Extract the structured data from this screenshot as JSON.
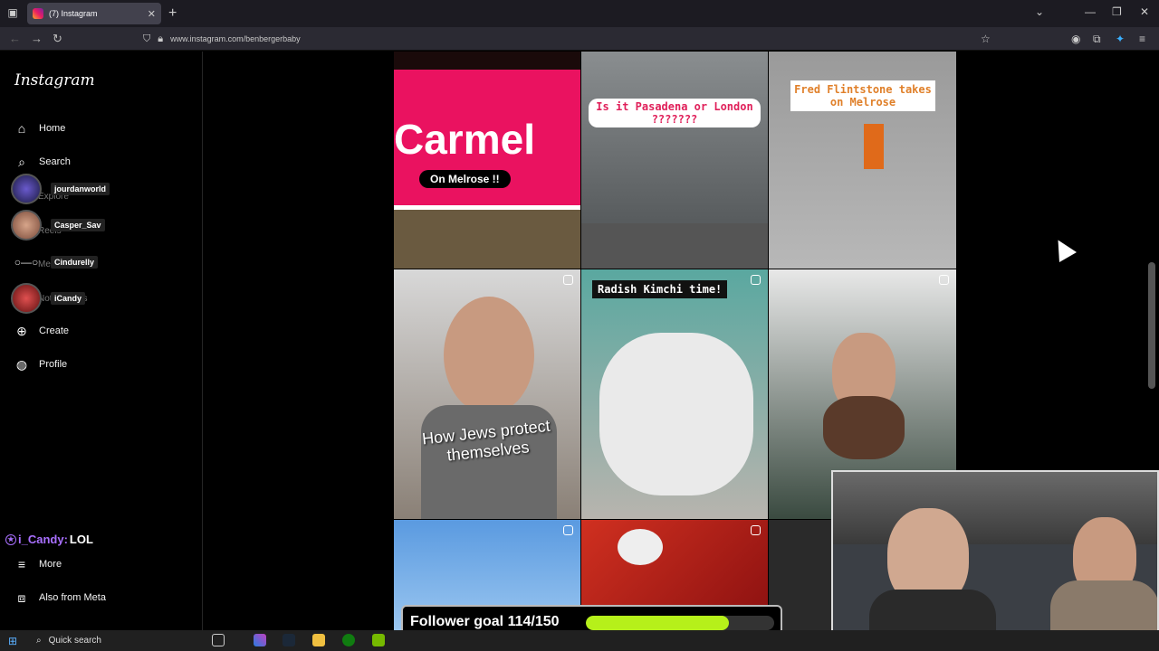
{
  "browser": {
    "tab_title": "(7) Instagram",
    "url": "www.instagram.com/benbergerbaby"
  },
  "sidebar": {
    "logo": "Instagram",
    "items": [
      {
        "label": "Home",
        "icon": "home-icon"
      },
      {
        "label": "Search",
        "icon": "search-icon"
      },
      {
        "label": "Explore",
        "icon": "compass-icon"
      },
      {
        "label": "Reels",
        "icon": "reels-icon"
      },
      {
        "label": "Messages",
        "icon": "messenger-icon"
      },
      {
        "label": "Notifications",
        "icon": "heart-icon"
      },
      {
        "label": "Create",
        "icon": "plus-icon"
      },
      {
        "label": "Profile",
        "icon": "avatar-icon"
      },
      {
        "label": "More",
        "icon": "menu-icon"
      },
      {
        "label": "Also from Meta",
        "icon": "meta-icon"
      }
    ],
    "overlay_users": [
      "jourdanworld",
      "Casper_Sav",
      "Cindurelly",
      "iCandy"
    ]
  },
  "chat": {
    "user": "i_Candy:",
    "message": "LOL"
  },
  "posts": [
    {
      "caption": "Carmel",
      "sub": "On Melrose !!"
    },
    {
      "caption": "Is it Pasadena or London ???????"
    },
    {
      "caption": "Fred Flintstone takes on Melrose"
    },
    {
      "caption": "How Jews protect themselves"
    },
    {
      "caption": "Radish Kimchi time!"
    },
    {
      "caption": ""
    }
  ],
  "follower_goal": {
    "label": "Follower goal 114/150",
    "progress": 0.76
  },
  "taskbar": {
    "search_label": "Quick search"
  },
  "colors": {
    "goal_fill": "#b6f01a",
    "chat_user": "#a970ff",
    "carmel_pink": "#ea1260"
  }
}
